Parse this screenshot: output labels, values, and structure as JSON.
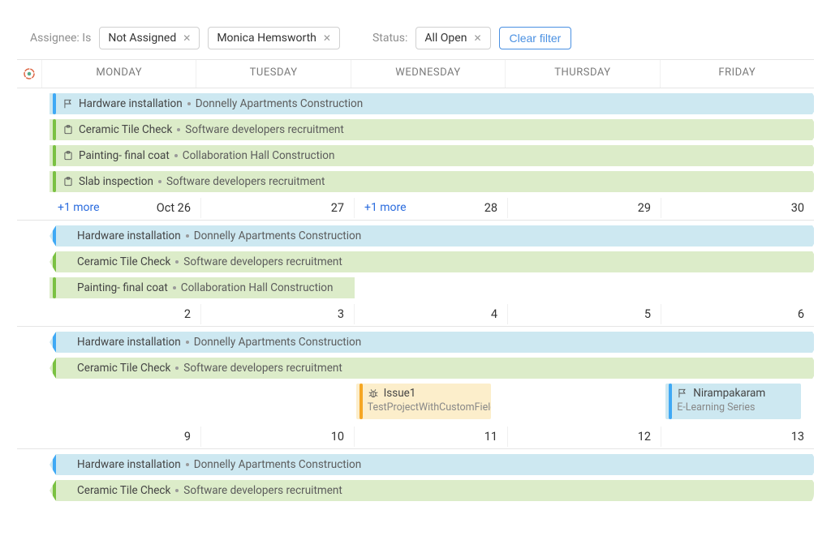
{
  "filters": {
    "assignee_label": "Assignee: Is",
    "chips": [
      "Not Assigned",
      "Monica Hemsworth"
    ],
    "status_label": "Status:",
    "status_chip": "All Open",
    "clear": "Clear filter"
  },
  "days": [
    "MONDAY",
    "TUESDAY",
    "WEDNESDAY",
    "THURSDAY",
    "FRIDAY"
  ],
  "weeks": [
    {
      "events": [
        {
          "color": "blue",
          "icon": "milestone",
          "title": "Hardware installation",
          "project": "Donnelly Apartments Construction",
          "start": 0,
          "end": 5,
          "openLeft": false,
          "openRight": true
        },
        {
          "color": "green",
          "icon": "task",
          "title": "Ceramic Tile Check",
          "project": "Software developers recruitment",
          "start": 0,
          "end": 5,
          "openLeft": false,
          "openRight": true
        },
        {
          "color": "green",
          "icon": "task",
          "title": "Painting- final coat",
          "project": "Collaboration Hall Construction",
          "start": 0,
          "end": 5,
          "openLeft": false,
          "openRight": true
        },
        {
          "color": "green",
          "icon": "task",
          "title": "Slab inspection",
          "project": "Software developers recruitment",
          "start": 0,
          "end": 5,
          "openLeft": false,
          "openRight": true
        }
      ],
      "dates": [
        {
          "label": "Oct 26",
          "more": "+1 more"
        },
        {
          "label": "27"
        },
        {
          "label": "28",
          "more": "+1 more"
        },
        {
          "label": "29"
        },
        {
          "label": "30"
        }
      ]
    },
    {
      "events": [
        {
          "color": "blue",
          "title": "Hardware installation",
          "project": "Donnelly Apartments Construction",
          "start": 0,
          "end": 5,
          "openLeft": true,
          "openRight": true,
          "indent": true
        },
        {
          "color": "green",
          "title": "Ceramic Tile Check",
          "project": "Software developers recruitment",
          "start": 0,
          "end": 5,
          "openLeft": true,
          "openRight": true,
          "indent": true
        },
        {
          "color": "green",
          "title": "Painting- final coat",
          "project": "Collaboration Hall Construction",
          "start": 0,
          "end": 2,
          "openLeft": true,
          "openRight": false,
          "indent": true
        }
      ],
      "dates": [
        {
          "label": "2"
        },
        {
          "label": "3"
        },
        {
          "label": "4"
        },
        {
          "label": "5"
        },
        {
          "label": "6"
        }
      ]
    },
    {
      "events": [
        {
          "color": "blue",
          "title": "Hardware installation",
          "project": "Donnelly Apartments Construction",
          "start": 0,
          "end": 5,
          "openLeft": true,
          "openRight": true,
          "indent": true
        },
        {
          "color": "green",
          "title": "Ceramic Tile Check",
          "project": "Software developers recruitment",
          "start": 0,
          "end": 5,
          "openLeft": true,
          "openRight": true,
          "indent": true
        }
      ],
      "positioned": [
        {
          "color": "yellow",
          "icon": "bug",
          "title": "Issue1",
          "sub": "TestProjectWithCustomFields",
          "col": 2,
          "span": 1
        },
        {
          "color": "blue",
          "icon": "milestone",
          "title": "Nirampakaram",
          "sub": "E-Learning Series",
          "col": 4,
          "span": 1
        }
      ],
      "dates": [
        {
          "label": "9"
        },
        {
          "label": "10"
        },
        {
          "label": "11"
        },
        {
          "label": "12"
        },
        {
          "label": "13"
        }
      ]
    },
    {
      "events": [
        {
          "color": "blue",
          "title": "Hardware installation",
          "project": "Donnelly Apartments Construction",
          "start": 0,
          "end": 5,
          "openLeft": true,
          "openRight": true,
          "indent": true
        },
        {
          "color": "green",
          "title": "Ceramic Tile Check",
          "project": "Software developers recruitment",
          "start": 0,
          "end": 5,
          "openLeft": true,
          "openRight": true,
          "indent": true
        }
      ],
      "dates": []
    }
  ]
}
